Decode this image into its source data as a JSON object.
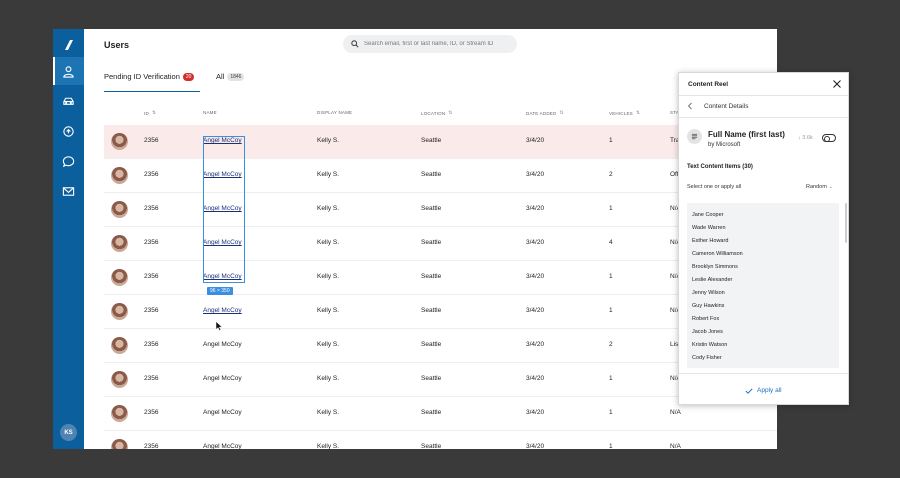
{
  "sidebar": {
    "user_initials": "KS",
    "items": [
      {
        "icon": "user-icon",
        "active": true
      },
      {
        "icon": "car-icon",
        "active": false
      },
      {
        "icon": "refresh-icon",
        "active": false
      },
      {
        "icon": "chat-icon",
        "active": false
      },
      {
        "icon": "mail-icon",
        "active": false
      }
    ]
  },
  "header": {
    "title": "Users",
    "search_placeholder": "Search email, first or last name, ID, or Stream ID"
  },
  "tabs": [
    {
      "label": "Pending ID Verification",
      "count": "20",
      "active": true
    },
    {
      "label": "All",
      "count": "1846",
      "active": false
    }
  ],
  "table": {
    "columns": [
      "ID",
      "NAME",
      "DISPLAY NAME",
      "LOCATION",
      "DATE ADDED",
      "VEHICLES",
      "STA"
    ],
    "rows": [
      {
        "id": "2356",
        "name": "Angel McCoy",
        "display": "Kelly S.",
        "location": "Seattle",
        "date": "3/4/20",
        "vehicles": "1",
        "status": "Tra"
      },
      {
        "id": "2356",
        "name": "Angel McCoy",
        "display": "Kelly S.",
        "location": "Seattle",
        "date": "3/4/20",
        "vehicles": "2",
        "status": "Off"
      },
      {
        "id": "2356",
        "name": "Angel McCoy",
        "display": "Kelly S.",
        "location": "Seattle",
        "date": "3/4/20",
        "vehicles": "1",
        "status": "N/A"
      },
      {
        "id": "2356",
        "name": "Angel McCoy",
        "display": "Kelly S.",
        "location": "Seattle",
        "date": "3/4/20",
        "vehicles": "4",
        "status": "N/A"
      },
      {
        "id": "2356",
        "name": "Angel McCoy",
        "display": "Kelly S.",
        "location": "Seattle",
        "date": "3/4/20",
        "vehicles": "1",
        "status": "N/A"
      },
      {
        "id": "2356",
        "name": "Angel McCoy",
        "display": "Kelly S.",
        "location": "Seattle",
        "date": "3/4/20",
        "vehicles": "1",
        "status": "N/A"
      },
      {
        "id": "2356",
        "name": "Angel McCoy",
        "display": "Kelly S.",
        "location": "Seattle",
        "date": "3/4/20",
        "vehicles": "2",
        "status": "Lis"
      },
      {
        "id": "2356",
        "name": "Angel McCoy",
        "display": "Kelly S.",
        "location": "Seattle",
        "date": "3/4/20",
        "vehicles": "1",
        "status": "N/A"
      },
      {
        "id": "2356",
        "name": "Angel McCoy",
        "display": "Kelly S.",
        "location": "Seattle",
        "date": "3/4/20",
        "vehicles": "1",
        "status": "N/A"
      },
      {
        "id": "2356",
        "name": "Angel McCoy",
        "display": "Kelly S.",
        "location": "Seattle",
        "date": "3/4/20",
        "vehicles": "1",
        "status": "N/A"
      }
    ]
  },
  "selection": {
    "dimension_label": "96 × 350"
  },
  "panel": {
    "title": "Content Reel",
    "subtitle": "Content Details",
    "item_title": "Full Name (first last)",
    "item_by": "by Microsoft",
    "item_count": "3.6k",
    "section_title": "Text Content Items (30)",
    "select_hint": "Select one or apply all",
    "random_label": "Random",
    "items": [
      "Jane Cooper",
      "Wade Warren",
      "Esther Howard",
      "Cameron Williamson",
      "Brooklyn Simmons",
      "Leslie Alexander",
      "Jenny Wilson",
      "Guy Hawkins",
      "Robert Fox",
      "Jacob Jones",
      "Kristin Watson",
      "Cody Fisher"
    ],
    "apply_label": "Apply all"
  },
  "colors": {
    "sidebar": "#0b5f9c",
    "accent": "#1c6fc0",
    "highlight_row": "#fbeaea",
    "badge": "#d62b2b"
  }
}
